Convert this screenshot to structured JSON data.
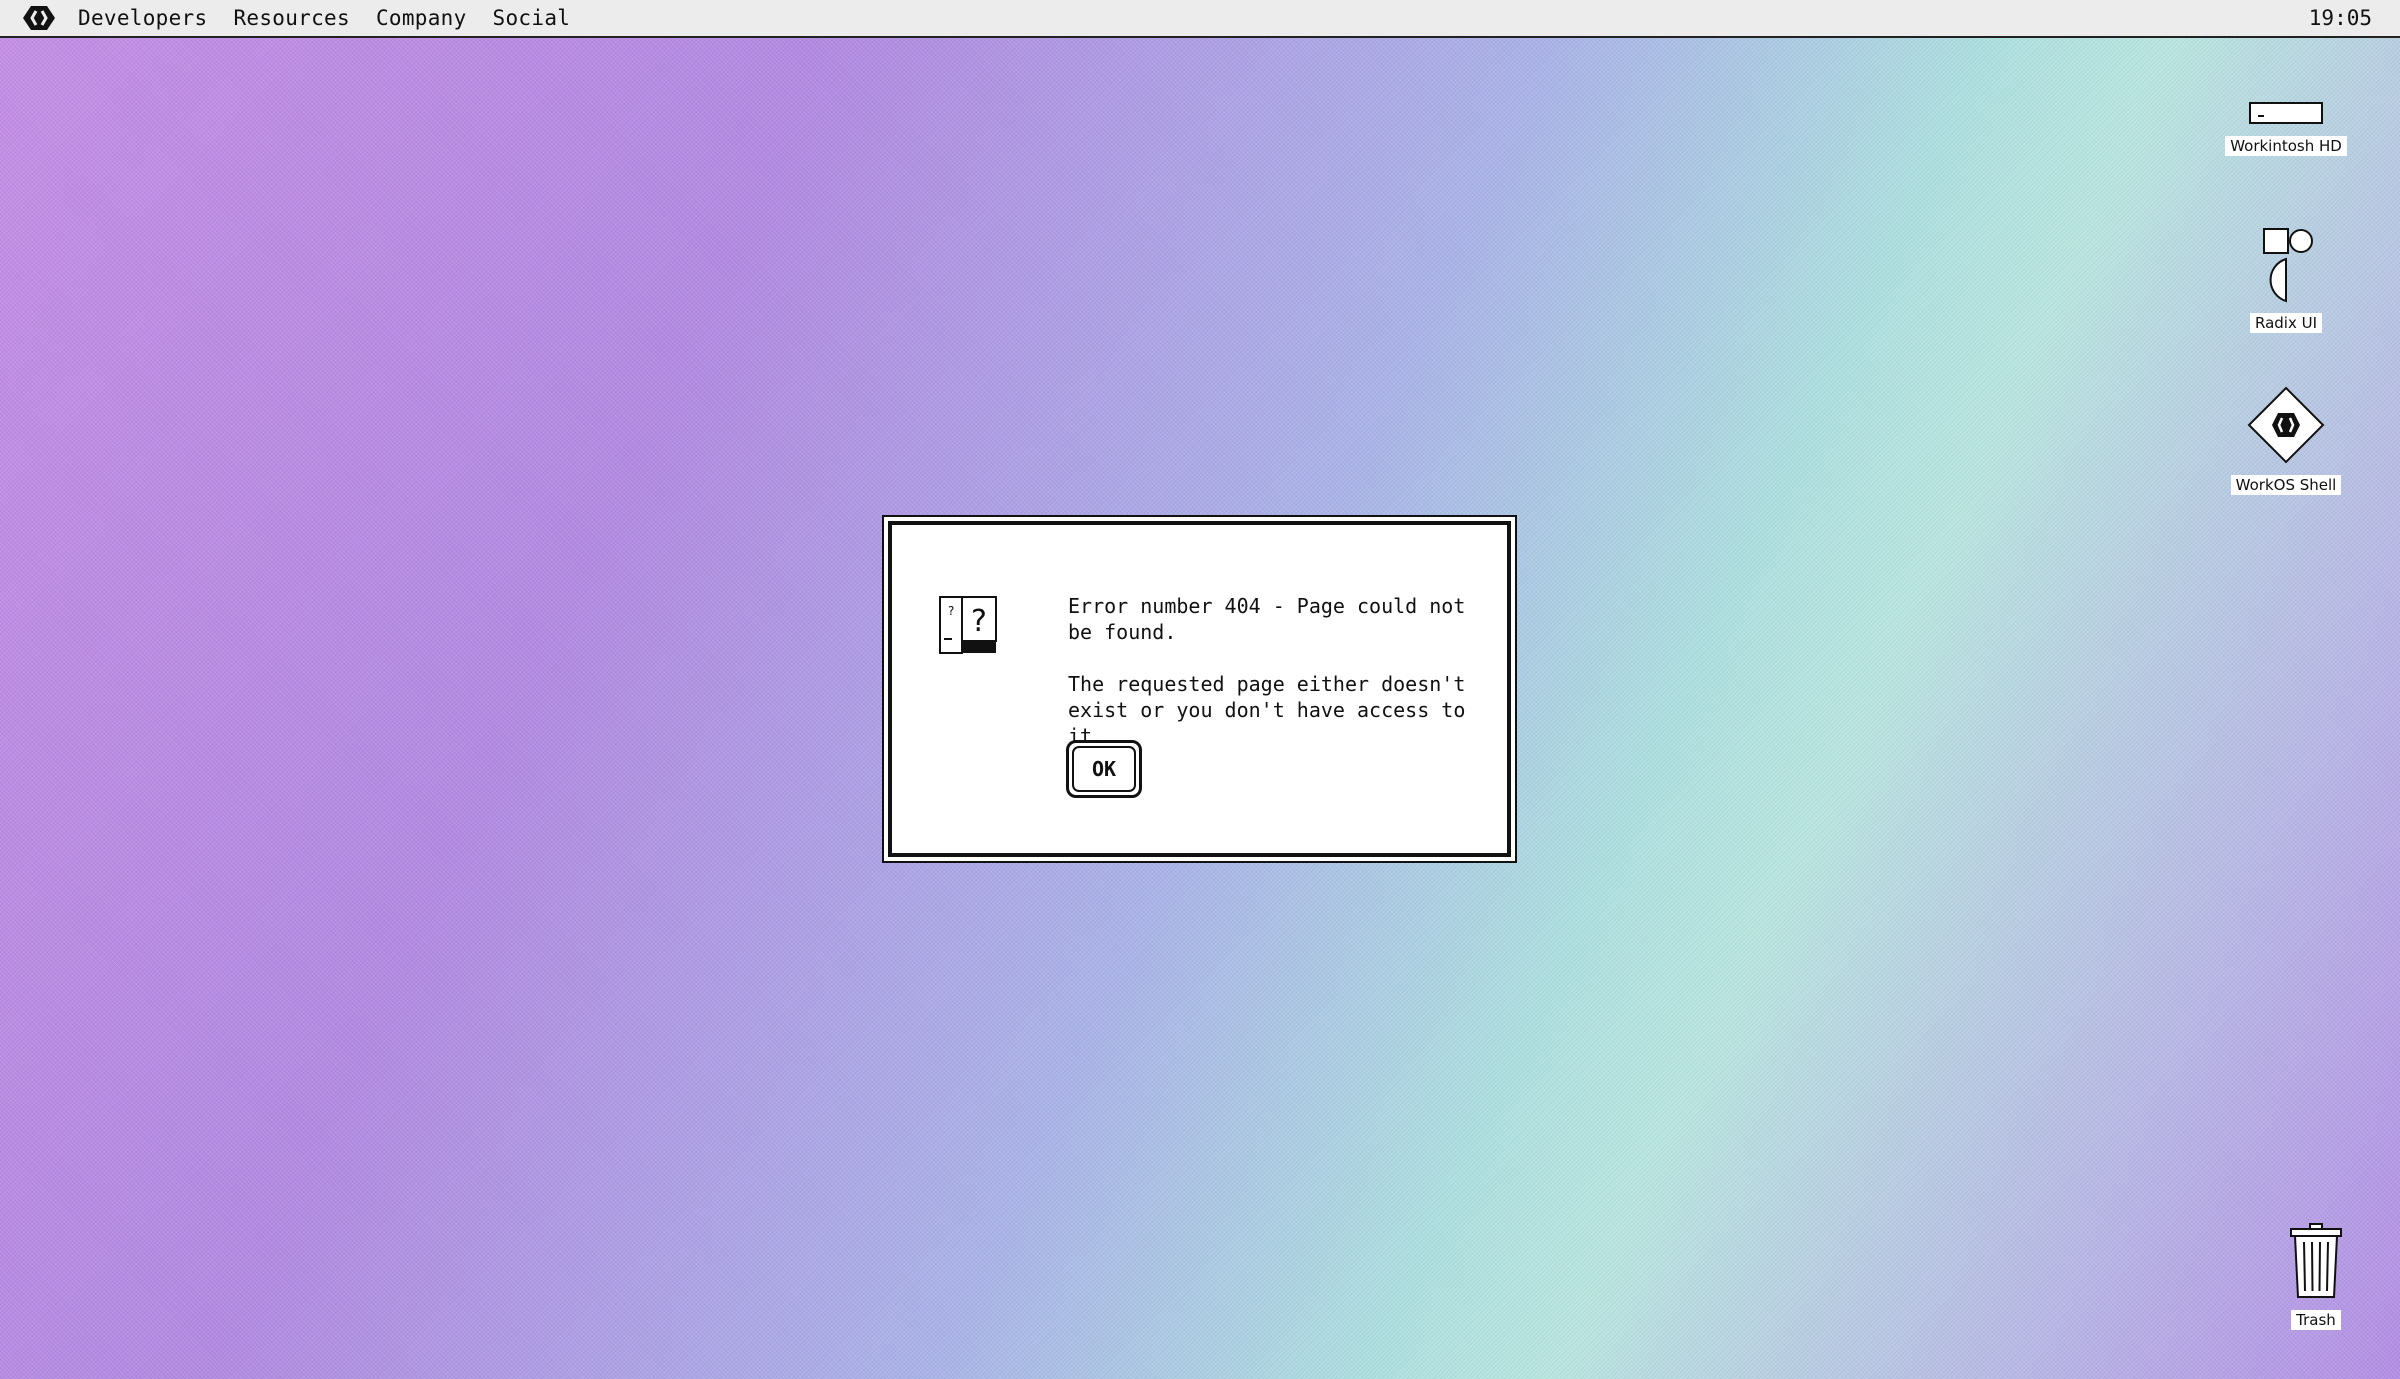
{
  "menubar": {
    "logo_icon": "workos-logo-icon",
    "items": [
      {
        "label": "Developers"
      },
      {
        "label": "Resources"
      },
      {
        "label": "Company"
      },
      {
        "label": "Social"
      }
    ],
    "clock": "19:05"
  },
  "desktop": {
    "icons": [
      {
        "label": "Workintosh HD",
        "icon": "hard-drive-icon"
      },
      {
        "label": "Radix UI",
        "icon": "radix-shapes-icon"
      },
      {
        "label": "WorkOS Shell",
        "icon": "workos-diamond-icon"
      },
      {
        "label": "Trash",
        "icon": "trash-icon"
      }
    ]
  },
  "dialog": {
    "icon": "question-document-icon",
    "message_line1": "Error number 404 - Page could not be found.",
    "message_line2": "The requested page either doesn't exist or you don't have access to it.",
    "ok_label": "OK"
  }
}
